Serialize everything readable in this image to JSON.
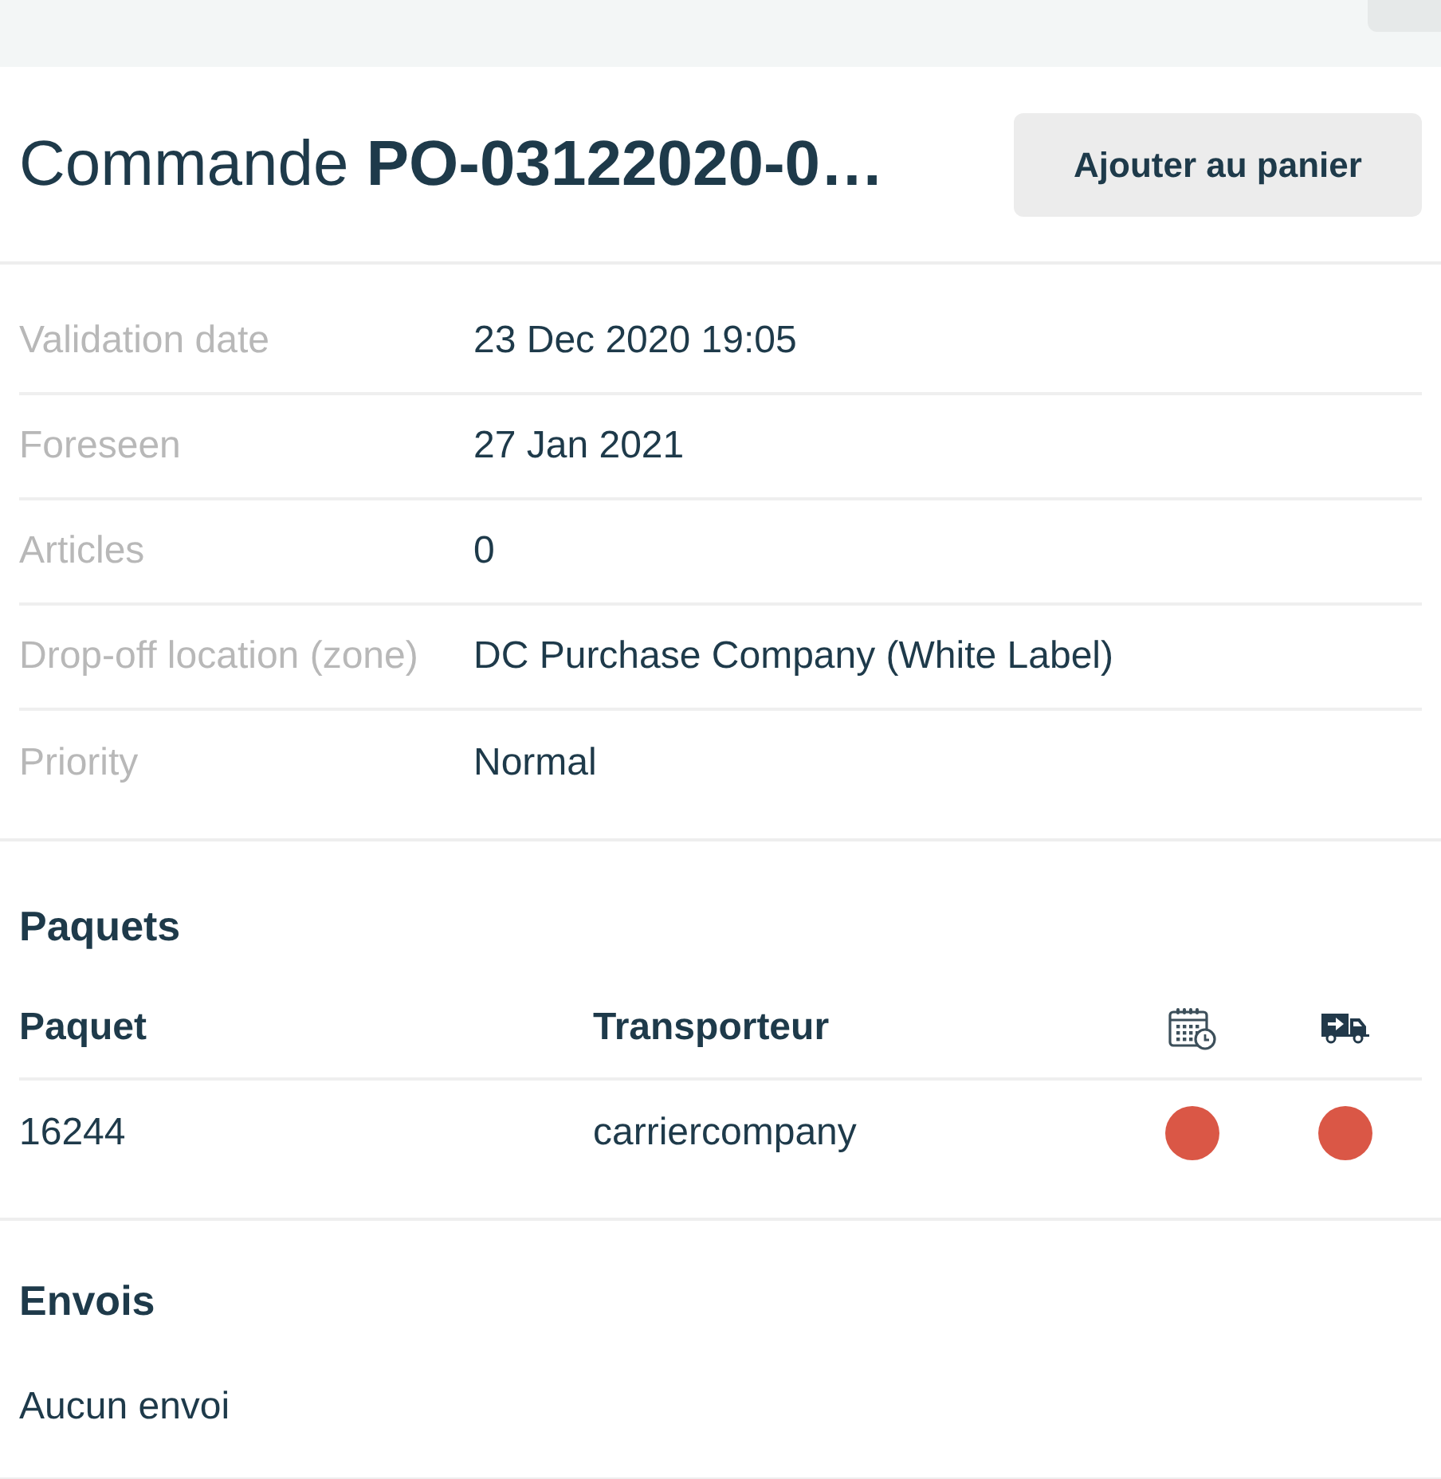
{
  "header": {
    "title": "Commande **PO-03122020-0…**",
    "button": "Ajouter au panier"
  },
  "details": [
    {
      "label": "Validation date",
      "value": "23 Dec 2020 19:05"
    },
    {
      "label": "Foreseen",
      "value": "27 Jan 2021"
    },
    {
      "label": "Articles",
      "value": "0"
    },
    {
      "label": "Drop-off location (zone)",
      "value": "DC Purchase Company (White Label)"
    },
    {
      "label": "Priority",
      "value": "Normal"
    }
  ],
  "packages": {
    "title": "Paquets",
    "columns": [
      {
        "kind": "text",
        "label": "Paquet"
      },
      {
        "kind": "text",
        "label": "Transporteur"
      },
      {
        "kind": "schedule"
      },
      {
        "kind": "shipping"
      }
    ],
    "rows": [
      {
        "cells": [
          {
            "kind": "text",
            "text": "16244"
          },
          {
            "kind": "text",
            "text": "carriercompany"
          },
          {
            "kind": "status",
            "color": "#da5746"
          },
          {
            "kind": "status",
            "color": "#da5746"
          }
        ]
      }
    ]
  },
  "shipments": {
    "title": "Envois",
    "empty_text": "Aucun envoi"
  }
}
